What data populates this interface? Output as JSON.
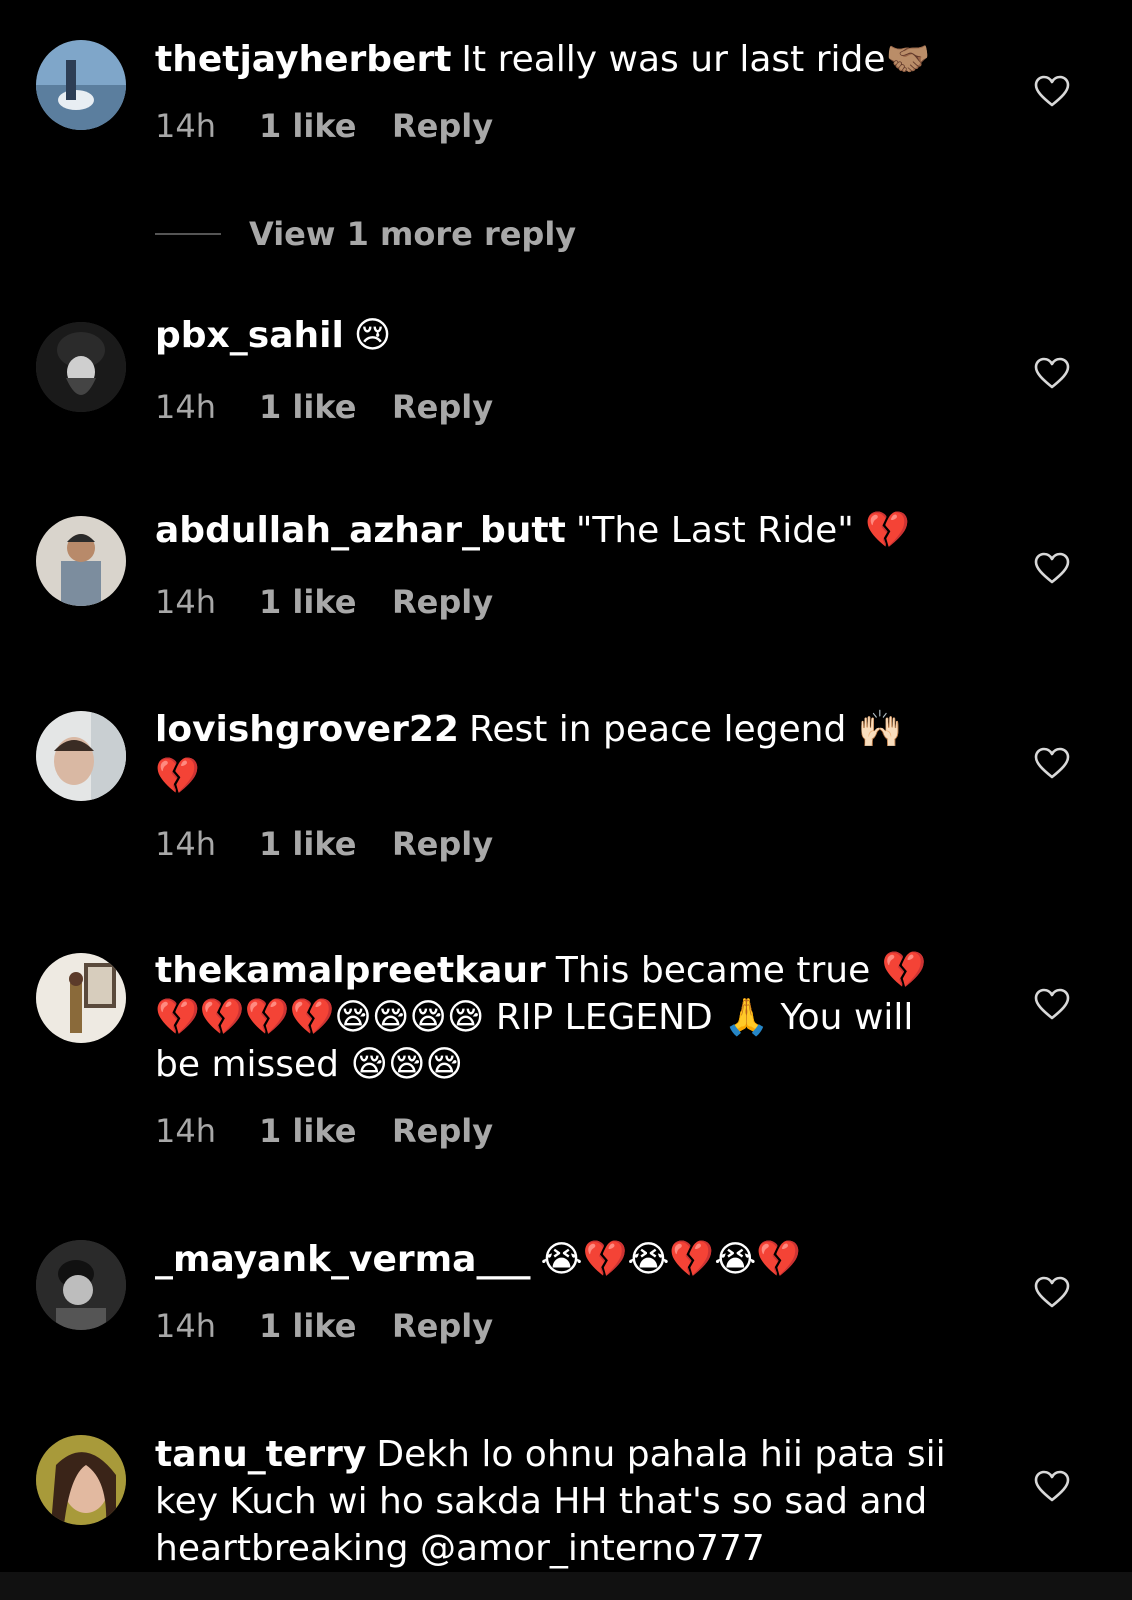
{
  "comments": [
    {
      "username": "thetjayherbert",
      "text": "It really was ur last ride🤝🏽",
      "time": "14h",
      "likes": "1 like",
      "reply": "Reply"
    },
    {
      "username": "pbx_sahil",
      "text": "😢",
      "time": "14h",
      "likes": "1 like",
      "reply": "Reply"
    },
    {
      "username": "abdullah_azhar_butt",
      "text": "\"The Last Ride\" 💔",
      "time": "14h",
      "likes": "1 like",
      "reply": "Reply"
    },
    {
      "username": "lovishgrover22",
      "text": "Rest in peace legend 🙌🏻 💔",
      "time": "14h",
      "likes": "1 like",
      "reply": "Reply"
    },
    {
      "username": "thekamalpreetkaur",
      "text": "This became true 💔 💔💔💔💔😪😪😪😪 RIP LEGEND 🙏 You will be missed 😪😪😪",
      "time": "14h",
      "likes": "1 like",
      "reply": "Reply"
    },
    {
      "username": "_mayank_verma___",
      "text": "😭💔😭💔😭💔",
      "time": "14h",
      "likes": "1 like",
      "reply": "Reply"
    },
    {
      "username": "tanu_terry",
      "text": "Dekh lo ohnu pahala hii pata sii key Kuch wi ho sakda HH that's so sad and heartbreaking @amor_interno777"
    }
  ],
  "view_more_replies": "View 1 more reply",
  "colors": {
    "background": "#000000",
    "primary_text": "#ffffff",
    "secondary_text": "#a8a8a8"
  },
  "icons": {
    "like": "heart-outline-icon"
  }
}
